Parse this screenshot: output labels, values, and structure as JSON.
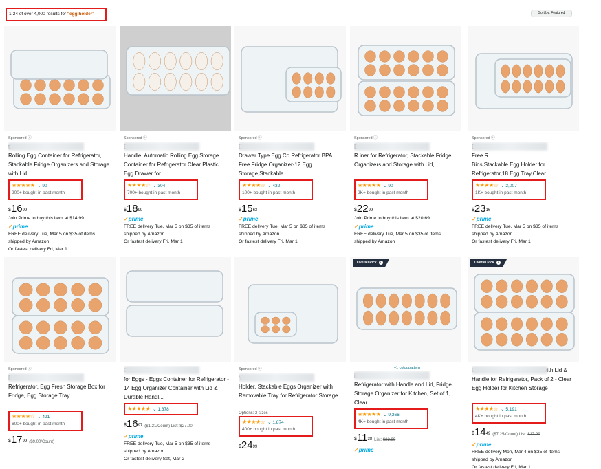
{
  "header": {
    "results_prefix": "1-24 of over 4,000 results for ",
    "query": "\"egg holder\"",
    "sort_label": "Sort by: Featured"
  },
  "products": [
    {
      "sponsored": "Sponsored",
      "title": "              tic\nRolling Egg Container for Refrigerator, Stackable Fridge Organizers and Storage with Lid,...",
      "rating_count": "90",
      "stars": "★★★★★",
      "bought": "200+ bought in past month",
      "price_whole": "16",
      "price_frac": "99",
      "line1": "Join Prime to buy this item at $14.99",
      "prime": true,
      "delivery": "FREE delivery Tue, Mar 5 on $35 of items",
      "shipped": "shipped by Amazon",
      "fastest": "Or fastest delivery Fri, Mar 1"
    },
    {
      "sponsored": "Sponsored",
      "title": "E                      th\nHandle, Automatic Rolling Egg Storage Container for Refrigerator Clear Plastic Egg Drawer for...",
      "rating_count": "304",
      "stars": "★★★★☆",
      "bought": "700+ bought in past month",
      "price_whole": "18",
      "price_frac": "99",
      "prime": true,
      "delivery": "FREE delivery Tue, Mar 5 on $35 of items",
      "shipped": "shipped by Amazon",
      "fastest": "Or fastest delivery Fri, Mar 1"
    },
    {
      "sponsored": "Sponsored",
      "title": "E                      r\nDrawer Type Egg Co       Refrigerator BPA Free Fridge Organizer-12 Egg Storage,Stackable",
      "rating_count": "432",
      "stars": "★★★★☆",
      "bought": "100+ bought in past month",
      "price_whole": "15",
      "price_frac": "63",
      "prime": true,
      "delivery": "FREE delivery Tue, Mar 5 on $35 of items",
      "shipped": "shipped by Amazon",
      "fastest": "Or fastest delivery Fri, Mar 1"
    },
    {
      "sponsored": "Sponsored",
      "title": "E                       tic\nR                 iner for Refrigerator, Stackable Fridge Organizers and Storage with Lid,...",
      "rating_count": "90",
      "stars": "★★★★★",
      "bought": "2K+ bought in past month",
      "price_whole": "22",
      "price_frac": "99",
      "line1": "Join Prime to buy this item at $20.69",
      "prime": true,
      "delivery": "FREE delivery Tue, Mar 5 on $35 of items",
      "shipped": "shipped by Amazon",
      "fastest": ""
    },
    {
      "sponsored": "Sponsored",
      "title": "E                      tor BPA\nFree R\nBins,Stackable Egg Holder for Refrigerator,18 Egg Tray,Clear",
      "rating_count": "2,007",
      "stars": "★★★★☆",
      "bought": "1K+ bought in past month",
      "price_whole": "23",
      "price_frac": "16",
      "prime": true,
      "delivery": "FREE delivery Tue, Mar 5 on $35 of items",
      "shipped": "shipped by Amazon",
      "fastest": "Or fastest delivery Fri, Mar 1"
    },
    {
      "sponsored": "Sponsored",
      "title": "R                 Container for\nRefrigerator, Egg Fresh Storage Box for Fridge, Egg Storage Tray...",
      "rating_count": "491",
      "stars": "★★★★☆",
      "bought": "600+ bought in past month",
      "price_whole": "17",
      "price_frac": "99",
      "price_extra": "($9.00/Count)"
    },
    {
      "title": "C                  anizer Bins\nfor Eggs - Eggs Container for Refrigerator - 14 Egg Organizer Container with Lid & Durable Handl...",
      "rating_count": "1,378",
      "stars": "★★★★★",
      "price_whole": "16",
      "price_frac": "97",
      "price_extra": "($1.21/Count) List: ",
      "price_list": "$27.00",
      "prime": true,
      "delivery": "FREE delivery Tue, Mar 5 on $35 of items",
      "shipped": "shipped by Amazon",
      "fastest": "Or fastest delivery Sat, Mar 2"
    },
    {
      "sponsored": "Sponsored",
      "title": "Ye\nHolder, Stackable Eggs Organizer with Removable Tray for Refrigerator Storage",
      "options": "Options: 2 sizes",
      "rating_count": "1,874",
      "stars": "★★★★☆",
      "bought": "400+ bought in past month",
      "price_whole": "24",
      "price_frac": "99"
    },
    {
      "overall_pick": "Overall Pick",
      "color_link": "+1 color/pattern",
      "title": "iD\nRefrigerator with Handle and Lid, Fridge Storage Organizer for Kitchen, Set of 1, Clear",
      "rating_count": "9,266",
      "stars": "★★★★★",
      "bought": "4K+ bought in past month",
      "price_whole": "11",
      "price_frac": "38",
      "price_extra": "List: ",
      "price_list": "$22.99",
      "prime": true
    },
    {
      "overall_pick": "Overall Pick",
      "title": "Utopia Home Egg Container With Lid & Handle for Refrigerator, Pack of 2 - Clear Egg Holder for Kitchen Storage",
      "rating_count": "5,191",
      "stars": "★★★★☆",
      "bought": "4K+ bought in past month",
      "price_whole": "14",
      "price_frac": "49",
      "price_extra": "($7.25/Count) List: ",
      "price_list": "$17.99",
      "prime": true,
      "delivery": "FREE delivery Mon, Mar 4 on $35 of items",
      "shipped": "shipped by Amazon",
      "fastest": "Or fastest delivery Fri, Mar 1"
    }
  ],
  "labels": {
    "prime": "prime",
    "currency": "$",
    "chevron": "v"
  }
}
